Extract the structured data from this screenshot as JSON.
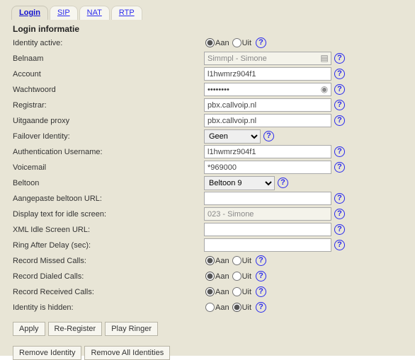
{
  "tabs": {
    "login": "Login",
    "sip": "SIP",
    "nat": "NAT",
    "rtp": "RTP"
  },
  "section_title": "Login informatie",
  "labels": {
    "identity_active": "Identity active:",
    "belnaam": "Belnaam",
    "account": "Account",
    "wachtwoord": "Wachtwoord",
    "registrar": "Registrar:",
    "uitgaande_proxy": "Uitgaande proxy",
    "failover": "Failover Identity:",
    "auth_user": "Authentication Username:",
    "voicemail": "Voicemail",
    "beltoon": "Beltoon",
    "aangepaste_url": "Aangepaste beltoon URL:",
    "display_text": "Display text for idle screen:",
    "xml_idle": "XML Idle Screen URL:",
    "ring_after": "Ring After Delay (sec):",
    "rec_missed": "Record Missed Calls:",
    "rec_dialed": "Record Dialed Calls:",
    "rec_received": "Record Received Calls:",
    "hidden": "Identity is hidden:"
  },
  "radio": {
    "aan": "Aan",
    "uit": "Uit"
  },
  "values": {
    "belnaam": "Simmpl - Simone",
    "account": "l1hwmrz904f1",
    "wachtwoord": "••••••••",
    "registrar": "pbx.callvoip.nl",
    "proxy": "pbx.callvoip.nl",
    "failover": "Geen",
    "auth_user": "l1hwmrz904f1",
    "voicemail": "*969000",
    "beltoon": "Beltoon 9",
    "aangepaste_url": "",
    "display_text": "023 - Simone",
    "xml_idle": "",
    "ring_after": ""
  },
  "buttons": {
    "apply": "Apply",
    "reregister": "Re-Register",
    "play_ringer": "Play Ringer",
    "remove_identity": "Remove Identity",
    "remove_all": "Remove All Identities"
  },
  "help_glyph": "?"
}
